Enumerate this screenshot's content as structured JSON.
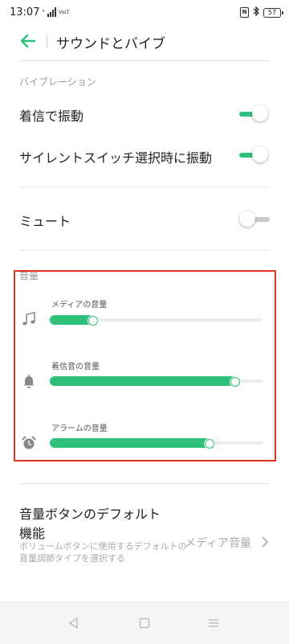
{
  "status_bar": {
    "time": "13:07",
    "network": "VoLTE",
    "battery": "57"
  },
  "header": {
    "title": "サウンドとバイブ",
    "back_icon": "back-arrow-icon"
  },
  "vibration": {
    "section_label": "バイブレーション",
    "incoming_label": "着信で振動",
    "incoming_on": true,
    "silent_switch_label": "サイレントスイッチ選択時に振動",
    "silent_switch_on": true
  },
  "mute": {
    "label": "ミュート",
    "on": false
  },
  "volume": {
    "section_label": "音量",
    "sliders": [
      {
        "label": "メディアの音量",
        "icon": "music-note-icon",
        "level": 0.21
      },
      {
        "label": "着信音の音量",
        "icon": "bell-icon",
        "level": 0.88
      },
      {
        "label": "アラームの音量",
        "icon": "alarm-clock-icon",
        "level": 0.76
      }
    ]
  },
  "default_function": {
    "title": "音量ボタンのデフォルト機能",
    "description": "ボリュームボタンに使用するデフォルトの音量調節タイプを選択する",
    "value": "メディア音量"
  },
  "colors": {
    "accent": "#2fc07a",
    "highlight_border": "#e0351f"
  },
  "nav": {
    "back": "nav-back-icon",
    "home": "nav-home-icon",
    "recents": "nav-menu-icon"
  }
}
